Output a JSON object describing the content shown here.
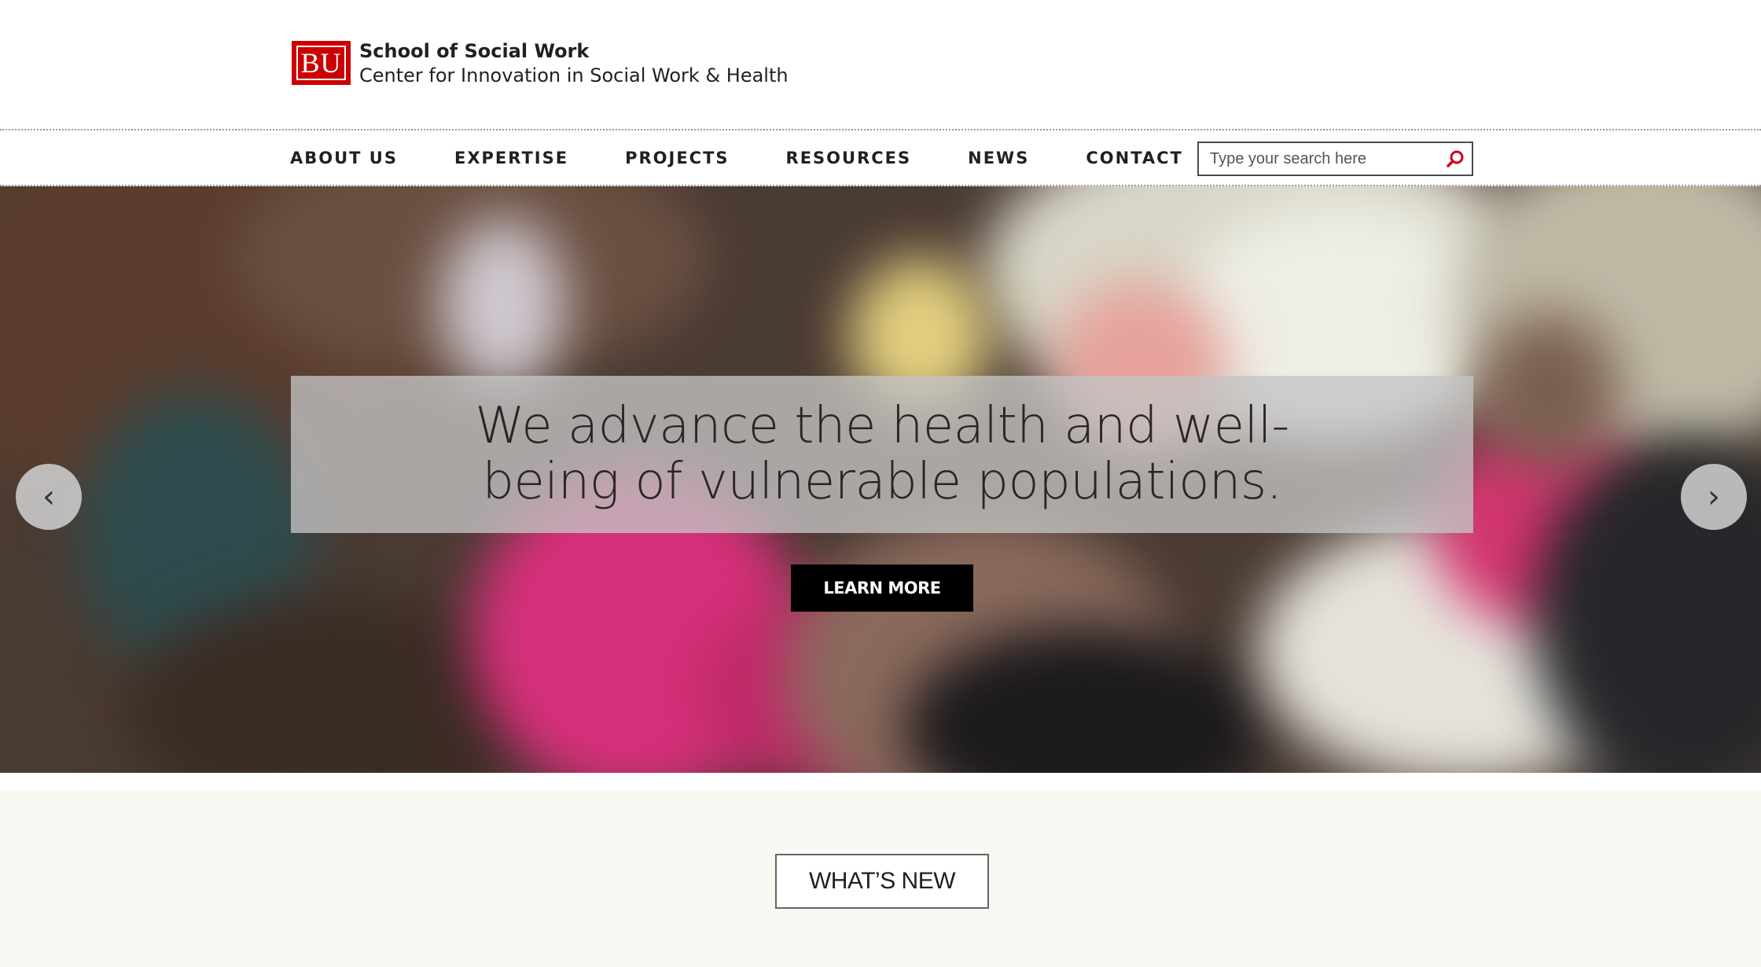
{
  "header": {
    "logo_mark": "BU",
    "school_name": "School of Social Work",
    "center_name": "Center for Innovation in Social Work & Health"
  },
  "nav": {
    "items": [
      {
        "label": "ABOUT US"
      },
      {
        "label": "EXPERTISE"
      },
      {
        "label": "PROJECTS"
      },
      {
        "label": "RESOURCES"
      },
      {
        "label": "NEWS"
      },
      {
        "label": "CONTACT"
      }
    ],
    "search": {
      "placeholder": "Type your search here",
      "value": "",
      "icon": "search-icon"
    }
  },
  "hero": {
    "tagline": "We advance the health and well-being of vulnerable populations.",
    "cta_label": "LEARN MORE",
    "prev_arrow": "‹",
    "next_arrow": "›",
    "image_description_icon": "blurred-meeting-photo"
  },
  "news_section": {
    "button_label": "WHAT’S NEW"
  },
  "colors": {
    "brand_red": "#cc0000",
    "text_dark": "#231f20",
    "section_bg": "#faf8f3",
    "cta_bg": "#000000"
  }
}
